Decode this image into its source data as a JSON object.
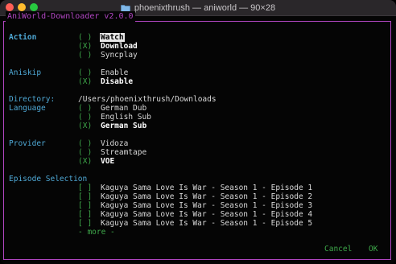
{
  "window": {
    "title": "phoenixthrush — aniworld — 90×28"
  },
  "app": {
    "frame_title": "AniWorld-Downloader v2.0.0"
  },
  "action": {
    "label": "Action",
    "options": [
      {
        "mark": "( )",
        "label": "Watch"
      },
      {
        "mark": "(X)",
        "label": "Download"
      },
      {
        "mark": "( )",
        "label": "Syncplay"
      }
    ]
  },
  "aniskip": {
    "label": "Aniskip",
    "options": [
      {
        "mark": "( )",
        "label": "Enable"
      },
      {
        "mark": "(X)",
        "label": "Disable"
      }
    ]
  },
  "directory": {
    "label": "Directory:",
    "value": "/Users/phoenixthrush/Downloads"
  },
  "language": {
    "label": "Language",
    "options": [
      {
        "mark": "( )",
        "label": "German Dub"
      },
      {
        "mark": "( )",
        "label": "English Sub"
      },
      {
        "mark": "(X)",
        "label": "German Sub"
      }
    ]
  },
  "provider": {
    "label": "Provider",
    "options": [
      {
        "mark": "( )",
        "label": "Vidoza"
      },
      {
        "mark": "( )",
        "label": "Streamtape"
      },
      {
        "mark": "(X)",
        "label": "VOE"
      }
    ]
  },
  "episodes": {
    "label": "Episode Selection",
    "items": [
      {
        "mark": "[ ]",
        "label": "Kaguya Sama Love Is War - Season 1 - Episode 1"
      },
      {
        "mark": "[ ]",
        "label": "Kaguya Sama Love Is War - Season 1 - Episode 2"
      },
      {
        "mark": "[ ]",
        "label": "Kaguya Sama Love Is War - Season 1 - Episode 3"
      },
      {
        "mark": "[ ]",
        "label": "Kaguya Sama Love Is War - Season 1 - Episode 4"
      },
      {
        "mark": "[ ]",
        "label": "Kaguya Sama Love Is War - Season 1 - Episode 5"
      }
    ],
    "more": "- more -"
  },
  "buttons": {
    "cancel": "Cancel",
    "ok": "OK"
  },
  "colors": {
    "accent_purple": "#b146c2",
    "label_blue": "#4fa9d6",
    "mark_green": "#3ea84a"
  },
  "icons": {
    "title_folder": "folder-icon"
  }
}
